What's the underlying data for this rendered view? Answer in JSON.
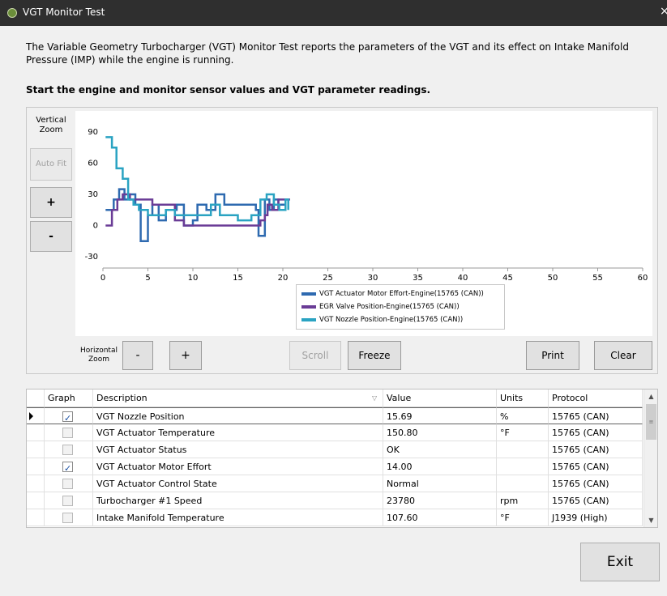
{
  "window": {
    "title": "VGT Monitor Test",
    "close_glyph": "×"
  },
  "description": "The Variable Geometry Turbocharger (VGT) Monitor Test reports the parameters of the VGT and its effect on Intake Manifold Pressure (IMP) while the engine is running.",
  "instruction": "Start the engine and monitor sensor values and VGT parameter readings.",
  "controls": {
    "vertical_zoom_label": "Vertical Zoom",
    "auto_fit": "Auto Fit",
    "zoom_in": "+",
    "zoom_out": "-",
    "horizontal_zoom_label": "Horizontal Zoom",
    "h_zoom_out": "-",
    "h_zoom_in": "+",
    "scroll": "Scroll",
    "freeze": "Freeze",
    "print": "Print",
    "clear": "Clear",
    "exit": "Exit"
  },
  "chart_data": {
    "type": "line",
    "xlim": [
      0,
      60
    ],
    "ylim": [
      -30,
      90
    ],
    "x_ticks": [
      0,
      5,
      10,
      15,
      20,
      25,
      30,
      35,
      40,
      45,
      50,
      55,
      60
    ],
    "y_ticks": [
      90,
      60,
      30,
      0,
      -30
    ],
    "grid": false,
    "legend_position": "bottom-center",
    "series": [
      {
        "name": "VGT Actuator Motor Effort-Engine(15765 (CAN))",
        "color": "#2e6ab0",
        "points": [
          [
            0.3,
            15
          ],
          [
            1.2,
            15
          ],
          [
            1.2,
            25
          ],
          [
            1.8,
            25
          ],
          [
            1.8,
            35
          ],
          [
            2.4,
            35
          ],
          [
            2.4,
            25
          ],
          [
            3.0,
            25
          ],
          [
            3.0,
            30
          ],
          [
            3.6,
            30
          ],
          [
            3.6,
            20
          ],
          [
            4.2,
            20
          ],
          [
            4.2,
            -15
          ],
          [
            5.0,
            -15
          ],
          [
            5.0,
            10
          ],
          [
            5.5,
            10
          ],
          [
            5.5,
            20
          ],
          [
            6.2,
            20
          ],
          [
            6.2,
            5
          ],
          [
            7.0,
            5
          ],
          [
            7.0,
            15
          ],
          [
            8.2,
            15
          ],
          [
            8.2,
            20
          ],
          [
            9.0,
            20
          ],
          [
            9.0,
            0
          ],
          [
            10.0,
            0
          ],
          [
            10.0,
            5
          ],
          [
            10.5,
            5
          ],
          [
            10.5,
            20
          ],
          [
            11.5,
            20
          ],
          [
            11.5,
            15
          ],
          [
            12.5,
            15
          ],
          [
            12.5,
            30
          ],
          [
            13.5,
            30
          ],
          [
            13.5,
            20
          ],
          [
            17.0,
            20
          ],
          [
            17.0,
            15
          ],
          [
            17.3,
            15
          ],
          [
            17.3,
            -10
          ],
          [
            18.0,
            -10
          ],
          [
            18.0,
            25
          ],
          [
            18.5,
            25
          ],
          [
            18.5,
            15
          ],
          [
            19.0,
            15
          ],
          [
            19.0,
            25
          ],
          [
            19.5,
            25
          ],
          [
            19.5,
            20
          ],
          [
            20.2,
            20
          ]
        ]
      },
      {
        "name": "EGR Valve Position-Engine(15765 (CAN))",
        "color": "#6a3c96",
        "points": [
          [
            0.3,
            0
          ],
          [
            1.0,
            0
          ],
          [
            1.0,
            15
          ],
          [
            1.6,
            15
          ],
          [
            1.6,
            25
          ],
          [
            2.2,
            25
          ],
          [
            2.2,
            30
          ],
          [
            3.0,
            30
          ],
          [
            3.0,
            25
          ],
          [
            5.5,
            25
          ],
          [
            5.5,
            20
          ],
          [
            8.0,
            20
          ],
          [
            8.0,
            5
          ],
          [
            9.0,
            5
          ],
          [
            9.0,
            0
          ],
          [
            17.5,
            0
          ],
          [
            17.5,
            5
          ],
          [
            18.0,
            5
          ],
          [
            18.0,
            10
          ],
          [
            18.3,
            10
          ],
          [
            18.3,
            20
          ],
          [
            18.8,
            20
          ],
          [
            18.8,
            15
          ],
          [
            19.5,
            15
          ],
          [
            19.5,
            25
          ],
          [
            20.8,
            25
          ]
        ]
      },
      {
        "name": "VGT Nozzle Position-Engine(15765 (CAN))",
        "color": "#2aa3c2",
        "points": [
          [
            0.3,
            85
          ],
          [
            1.0,
            85
          ],
          [
            1.0,
            75
          ],
          [
            1.5,
            75
          ],
          [
            1.5,
            55
          ],
          [
            2.2,
            55
          ],
          [
            2.2,
            45
          ],
          [
            2.8,
            45
          ],
          [
            2.8,
            25
          ],
          [
            3.4,
            25
          ],
          [
            3.4,
            20
          ],
          [
            4.0,
            20
          ],
          [
            4.0,
            15
          ],
          [
            5.0,
            15
          ],
          [
            5.0,
            10
          ],
          [
            7.0,
            10
          ],
          [
            7.0,
            15
          ],
          [
            8.0,
            15
          ],
          [
            8.0,
            10
          ],
          [
            12.0,
            10
          ],
          [
            12.0,
            20
          ],
          [
            13.0,
            20
          ],
          [
            13.0,
            10
          ],
          [
            15.0,
            10
          ],
          [
            15.0,
            5
          ],
          [
            16.5,
            5
          ],
          [
            16.5,
            10
          ],
          [
            17.5,
            10
          ],
          [
            17.5,
            25
          ],
          [
            18.2,
            25
          ],
          [
            18.2,
            30
          ],
          [
            19.0,
            30
          ],
          [
            19.0,
            20
          ],
          [
            19.6,
            20
          ],
          [
            19.6,
            15
          ],
          [
            20.3,
            15
          ],
          [
            20.3,
            25
          ],
          [
            20.6,
            25
          ],
          [
            20.6,
            15
          ]
        ]
      }
    ]
  },
  "grid": {
    "columns": [
      "Graph",
      "Description",
      "Value",
      "Units",
      "Protocol"
    ],
    "rows": [
      {
        "graph": true,
        "description": "VGT Nozzle Position",
        "value": "15.69",
        "units": "%",
        "protocol": "15765 (CAN)",
        "selected": true
      },
      {
        "graph": false,
        "description": "VGT Actuator Temperature",
        "value": "150.80",
        "units": "°F",
        "protocol": "15765 (CAN)"
      },
      {
        "graph": false,
        "description": "VGT Actuator Status",
        "value": "OK",
        "units": "",
        "protocol": "15765 (CAN)"
      },
      {
        "graph": true,
        "description": "VGT Actuator Motor Effort",
        "value": "14.00",
        "units": "",
        "protocol": "15765 (CAN)"
      },
      {
        "graph": false,
        "description": "VGT Actuator Control State",
        "value": "Normal",
        "units": "",
        "protocol": "15765 (CAN)"
      },
      {
        "graph": false,
        "description": "Turbocharger #1 Speed",
        "value": "23780",
        "units": "rpm",
        "protocol": "15765 (CAN)"
      },
      {
        "graph": false,
        "description": "Intake Manifold Temperature",
        "value": "107.60",
        "units": "°F",
        "protocol": "J1939 (High)"
      }
    ]
  }
}
